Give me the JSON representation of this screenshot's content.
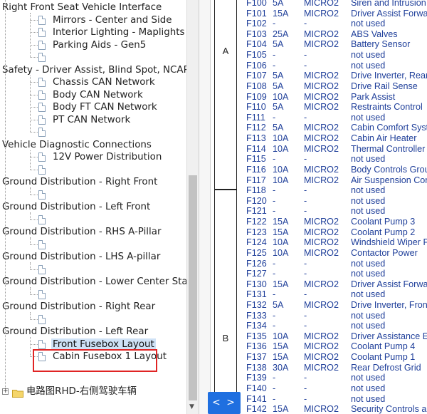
{
  "tree": {
    "items": [
      {
        "kind": "text",
        "label": "Right Front Seat Vehicle Interface"
      },
      {
        "kind": "leaf",
        "label": "Mirrors - Center and Side"
      },
      {
        "kind": "leaf",
        "label": "Interior Lighting - Maplights"
      },
      {
        "kind": "leaf",
        "label": "Parking Aids - Gen5"
      },
      {
        "kind": "leaf",
        "label": ""
      },
      {
        "kind": "text",
        "label": "Safety - Driver Assist, Blind Spot, NCAP"
      },
      {
        "kind": "leaf",
        "label": "Chassis CAN Network"
      },
      {
        "kind": "leaf",
        "label": "Body CAN Network"
      },
      {
        "kind": "leaf",
        "label": "Body FT CAN Network"
      },
      {
        "kind": "leaf",
        "label": "PT CAN Network"
      },
      {
        "kind": "leaf",
        "label": ""
      },
      {
        "kind": "text",
        "label": "Vehicle Diagnostic Connections"
      },
      {
        "kind": "leaf",
        "label": "12V Power Distribution"
      },
      {
        "kind": "leaf",
        "label": ""
      },
      {
        "kind": "text",
        "label": "Ground Distribution - Right Front"
      },
      {
        "kind": "leaf",
        "label": ""
      },
      {
        "kind": "text",
        "label": "Ground Distribution - Left Front"
      },
      {
        "kind": "leaf",
        "label": ""
      },
      {
        "kind": "text",
        "label": "Ground Distribution - RHS A-Pillar"
      },
      {
        "kind": "leaf",
        "label": ""
      },
      {
        "kind": "text",
        "label": "Ground Distribution - LHS A-pillar"
      },
      {
        "kind": "leaf",
        "label": ""
      },
      {
        "kind": "text",
        "label": "Ground Distribution - Lower Center Stack"
      },
      {
        "kind": "leaf",
        "label": ""
      },
      {
        "kind": "text",
        "label": "Ground Distribution - Right Rear"
      },
      {
        "kind": "leaf",
        "label": ""
      },
      {
        "kind": "text",
        "label": "Ground Distribution - Left Rear"
      },
      {
        "kind": "leaf",
        "label": "Front Fusebox Layout",
        "selected": true
      },
      {
        "kind": "leaf",
        "label": "Cabin Fusebox 1 Layout"
      }
    ],
    "folder": {
      "expander": "+",
      "label": "电路图RHD-右侧驾驶车辆"
    }
  },
  "sections": [
    "A",
    "B"
  ],
  "nav_label": "< >",
  "fuses": [
    [
      "F100",
      "5A",
      "MICRO2",
      "Siren and Intrusion"
    ],
    [
      "F101",
      "15A",
      "MICRO2",
      "Driver Assist Forward"
    ],
    [
      "F102",
      "-",
      "-",
      "not used"
    ],
    [
      "F103",
      "25A",
      "MICRO2",
      "ABS Valves"
    ],
    [
      "F104",
      "5A",
      "MICRO2",
      "Battery Sensor"
    ],
    [
      "F105",
      "-",
      "-",
      "not used"
    ],
    [
      "F106",
      "-",
      "-",
      "not used"
    ],
    [
      "F107",
      "5A",
      "MICRO2",
      "Drive Inverter, Rear"
    ],
    [
      "F108",
      "5A",
      "MICRO2",
      "Drive Rail Sense"
    ],
    [
      "F109",
      "10A",
      "MICRO2",
      "Park Assist"
    ],
    [
      "F110",
      "5A",
      "MICRO2",
      "Restraints Control"
    ],
    [
      "F111",
      "-",
      "-",
      "not used"
    ],
    [
      "F112",
      "5A",
      "MICRO2",
      "Cabin Comfort System"
    ],
    [
      "F113",
      "10A",
      "MICRO2",
      "Cabin Air Heater"
    ],
    [
      "F114",
      "10A",
      "MICRO2",
      "Thermal Controller"
    ],
    [
      "F115",
      "-",
      "-",
      "not used"
    ],
    [
      "F116",
      "10A",
      "MICRO2",
      "Body Controls Group"
    ],
    [
      "F117",
      "10A",
      "MICRO2",
      "Air Suspension Control"
    ],
    [
      "F118",
      "-",
      "-",
      "not used"
    ],
    [
      "F120",
      "-",
      "-",
      "not used"
    ],
    [
      "F121",
      "-",
      "-",
      "not used"
    ],
    [
      "F122",
      "15A",
      "MICRO2",
      "Coolant Pump 3"
    ],
    [
      "F123",
      "15A",
      "MICRO2",
      "Coolant Pump 2"
    ],
    [
      "F124",
      "10A",
      "MICRO2",
      "Windshield Wiper Park"
    ],
    [
      "F125",
      "10A",
      "MICRO2",
      "Contactor Power"
    ],
    [
      "F126",
      "-",
      "-",
      "not used"
    ],
    [
      "F127",
      "-",
      "-",
      "not used"
    ],
    [
      "F130",
      "15A",
      "MICRO2",
      "Driver Assist Forward"
    ],
    [
      "F131",
      "-",
      "-",
      "not used"
    ],
    [
      "F132",
      "5A",
      "MICRO2",
      "Drive Inverter, Front"
    ],
    [
      "F133",
      "-",
      "-",
      "not used"
    ],
    [
      "F134",
      "-",
      "-",
      "not used"
    ],
    [
      "F135",
      "10A",
      "MICRO2",
      "Driver Assistance ECU"
    ],
    [
      "F136",
      "15A",
      "MICRO2",
      "Coolant Pump 4"
    ],
    [
      "F137",
      "15A",
      "MICRO2",
      "Coolant Pump 1"
    ],
    [
      "F138",
      "30A",
      "MICRO2",
      "Rear Defrost Grid"
    ],
    [
      "F139",
      "-",
      "-",
      "not used"
    ],
    [
      "F140",
      "-",
      "-",
      "not used"
    ],
    [
      "F141",
      "-",
      "-",
      "not used"
    ],
    [
      "F142",
      "15A",
      "MICRO2",
      "Security Controls and"
    ]
  ]
}
